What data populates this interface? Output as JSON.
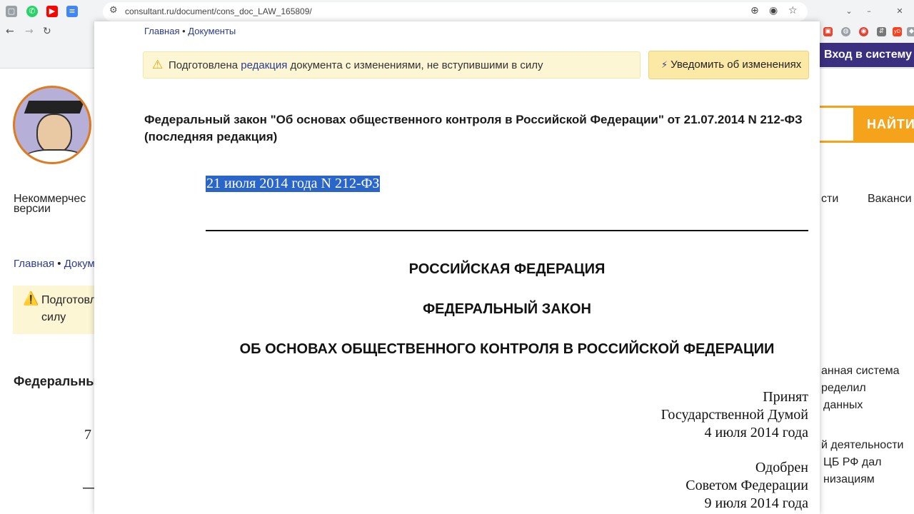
{
  "browser": {
    "url": "consultant.ru/document/cons_doc_LAW_165809/",
    "back_icon": "←",
    "forward_icon": "→",
    "reload_icon": "↻"
  },
  "background_page": {
    "login_label": "Вход в систему",
    "search_button": "НАЙТИ",
    "nav_left_line1": "Некоммерчес",
    "nav_left_line2": "версии",
    "nav_right_1": "сти",
    "nav_right_2": "Ваканси",
    "breadcrumb_home": "Главная",
    "breadcrumb_sep": " • ",
    "breadcrumb_docs_cut": "Докум",
    "notice_line1": "Подготовл",
    "notice_line2": "силу",
    "title_cut": "Федеральны",
    "number_cut": "7",
    "dash_cut": "—",
    "side_lines": [
      "анная система",
      "ределил",
      "данных",
      "й деятельности",
      "ЦБ РФ дал",
      "низациям"
    ]
  },
  "document": {
    "breadcrumb": {
      "home": "Главная",
      "separator": " • ",
      "docs": "Документы"
    },
    "notice": {
      "prefix": "Подготовлена ",
      "link": "редакция",
      "suffix": " документа с изменениями, не вступившими в силу"
    },
    "notify_button": "Уведомить об изменениях",
    "title": "Федеральный закон \"Об основах общественного контроля в Российской Федерации\" от 21.07.2014 N 212-ФЗ (последняя редакция)",
    "number_line": "21 июля 2014 года N 212-ФЗ",
    "heading_country": "РОССИЙСКАЯ ФЕДЕРАЦИЯ",
    "heading_type": "ФЕДЕРАЛЬНЫЙ ЗАКОН",
    "heading_name": "ОБ ОСНОВАХ ОБЩЕСТВЕННОГО КОНТРОЛЯ В РОССИЙСКОЙ ФЕДЕРАЦИИ",
    "adopted": {
      "line1": "Принят",
      "line2": "Государственной Думой",
      "line3": "4 июля 2014 года"
    },
    "approved": {
      "line1": "Одобрен",
      "line2": "Советом Федерации",
      "line3": "9 июля 2014 года"
    }
  },
  "colors": {
    "link": "#2b3c8f",
    "notice_bg": "#fdf6d4",
    "button_bg": "#fce9a6",
    "selection": "#2a66c9",
    "accent_orange": "#f5a31a",
    "login_bg": "#3b2f7f"
  }
}
